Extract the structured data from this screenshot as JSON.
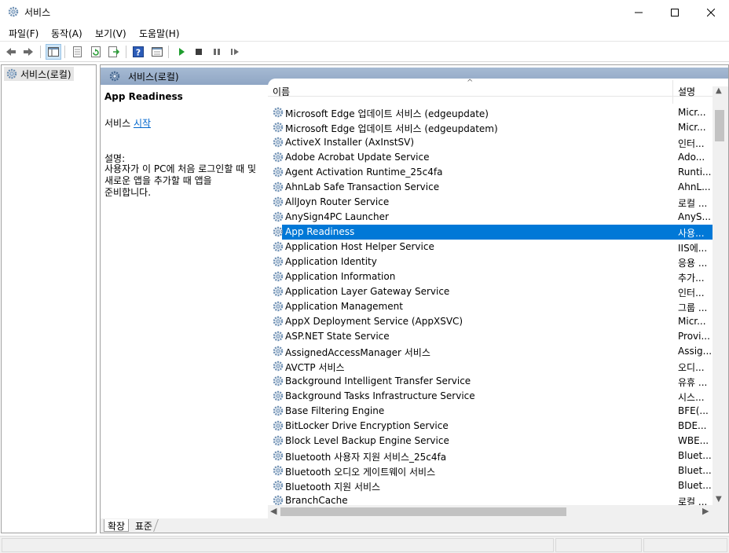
{
  "window": {
    "title": "서비스",
    "icon": "services-gear-icon"
  },
  "menu": {
    "items": [
      {
        "label": "파일(F)"
      },
      {
        "label": "동작(A)"
      },
      {
        "label": "보기(V)"
      },
      {
        "label": "도움말(H)"
      }
    ]
  },
  "toolbar": {
    "buttons": [
      "back-arrow-icon",
      "forward-arrow-icon",
      "console-tree-icon",
      "properties-icon",
      "refresh-icon",
      "export-list-icon",
      "help-icon",
      "view-icon",
      "play-icon",
      "stop-icon",
      "pause-icon",
      "resume-icon"
    ]
  },
  "tree": {
    "root_label": "서비스(로컬)"
  },
  "content": {
    "header": "서비스(로컬)",
    "selected_service": "App Readiness",
    "start_prefix": "서비스 ",
    "start_link": "시작",
    "desc_label": "설명:",
    "desc_text": "사용자가 이 PC에 처음 로그인할 때 및 새로운 앱을 추가할 때 앱을 준비합니다."
  },
  "list": {
    "col_name": "이름",
    "col_desc": "설명",
    "rows": [
      {
        "name": "Microsoft Edge 업데이트 서비스 (edgeupdate)",
        "desc": "Micr..."
      },
      {
        "name": "Microsoft Edge 업데이트 서비스 (edgeupdatem)",
        "desc": "Micr..."
      },
      {
        "name": "ActiveX Installer (AxInstSV)",
        "desc": "인터..."
      },
      {
        "name": "Adobe Acrobat Update Service",
        "desc": "Ado..."
      },
      {
        "name": "Agent Activation Runtime_25c4fa",
        "desc": "Runti..."
      },
      {
        "name": "AhnLab Safe Transaction Service",
        "desc": "AhnL..."
      },
      {
        "name": "AllJoyn Router Service",
        "desc": "로컬 ..."
      },
      {
        "name": "AnySign4PC Launcher",
        "desc": "AnyS..."
      },
      {
        "name": "App Readiness",
        "desc": "사용...",
        "selected": true
      },
      {
        "name": "Application Host Helper Service",
        "desc": "IIS에..."
      },
      {
        "name": "Application Identity",
        "desc": "응용 ..."
      },
      {
        "name": "Application Information",
        "desc": "추가..."
      },
      {
        "name": "Application Layer Gateway Service",
        "desc": "인터..."
      },
      {
        "name": "Application Management",
        "desc": "그룹 ..."
      },
      {
        "name": "AppX Deployment Service (AppXSVC)",
        "desc": "Micr..."
      },
      {
        "name": "ASP.NET State Service",
        "desc": "Provi..."
      },
      {
        "name": "AssignedAccessManager 서비스",
        "desc": "Assig..."
      },
      {
        "name": "AVCTP 서비스",
        "desc": "오디..."
      },
      {
        "name": "Background Intelligent Transfer Service",
        "desc": "유휴 ..."
      },
      {
        "name": "Background Tasks Infrastructure Service",
        "desc": "시스..."
      },
      {
        "name": "Base Filtering Engine",
        "desc": "BFE(..."
      },
      {
        "name": "BitLocker Drive Encryption Service",
        "desc": "BDE..."
      },
      {
        "name": "Block Level Backup Engine Service",
        "desc": "WBE..."
      },
      {
        "name": "Bluetooth 사용자 지원 서비스_25c4fa",
        "desc": "Bluet..."
      },
      {
        "name": "Bluetooth 오디오 게이트웨이 서비스",
        "desc": "Bluet..."
      },
      {
        "name": "Bluetooth 지원 서비스",
        "desc": "Bluet..."
      },
      {
        "name": "BranchCache",
        "desc": "로컬 ..."
      }
    ]
  },
  "tabs": {
    "extended": "확장",
    "standard": "표준"
  },
  "colors": {
    "selection": "#0078d7",
    "header_gradient_top": "#a6bad3",
    "link": "#0066cc"
  }
}
